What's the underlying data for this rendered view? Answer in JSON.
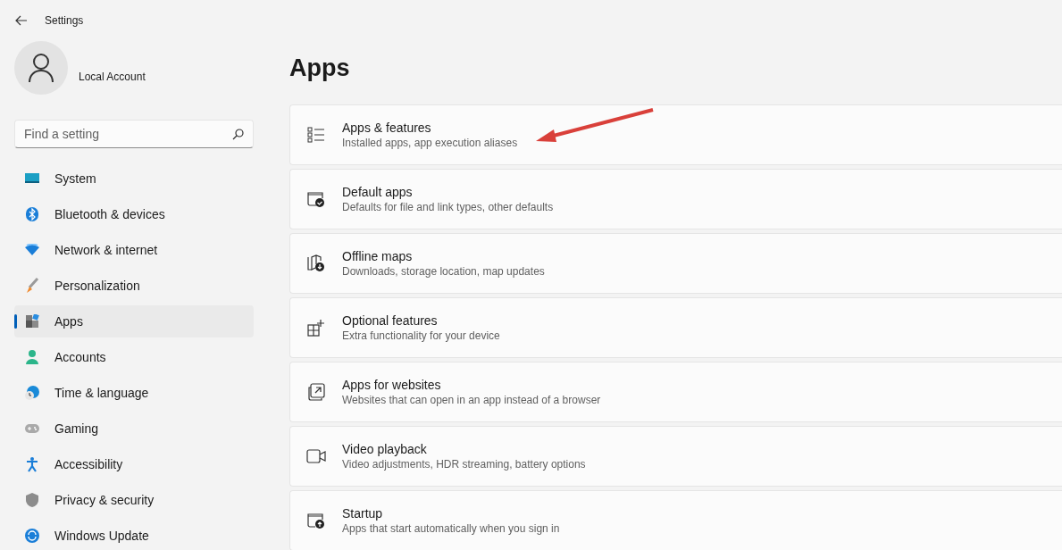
{
  "window": {
    "title": "Settings"
  },
  "account": {
    "name": "Local Account"
  },
  "search": {
    "placeholder": "Find a setting"
  },
  "sidebar": {
    "items": [
      {
        "label": "System",
        "selected": false
      },
      {
        "label": "Bluetooth & devices",
        "selected": false
      },
      {
        "label": "Network & internet",
        "selected": false
      },
      {
        "label": "Personalization",
        "selected": false
      },
      {
        "label": "Apps",
        "selected": true
      },
      {
        "label": "Accounts",
        "selected": false
      },
      {
        "label": "Time & language",
        "selected": false
      },
      {
        "label": "Gaming",
        "selected": false
      },
      {
        "label": "Accessibility",
        "selected": false
      },
      {
        "label": "Privacy & security",
        "selected": false
      },
      {
        "label": "Windows Update",
        "selected": false
      }
    ]
  },
  "page": {
    "title": "Apps",
    "items": [
      {
        "title": "Apps & features",
        "description": "Installed apps, app execution aliases"
      },
      {
        "title": "Default apps",
        "description": "Defaults for file and link types, other defaults"
      },
      {
        "title": "Offline maps",
        "description": "Downloads, storage location, map updates"
      },
      {
        "title": "Optional features",
        "description": "Extra functionality for your device"
      },
      {
        "title": "Apps for websites",
        "description": "Websites that can open in an app instead of a browser"
      },
      {
        "title": "Video playback",
        "description": "Video adjustments, HDR streaming, battery options"
      },
      {
        "title": "Startup",
        "description": "Apps that start automatically when you sign in"
      }
    ]
  }
}
